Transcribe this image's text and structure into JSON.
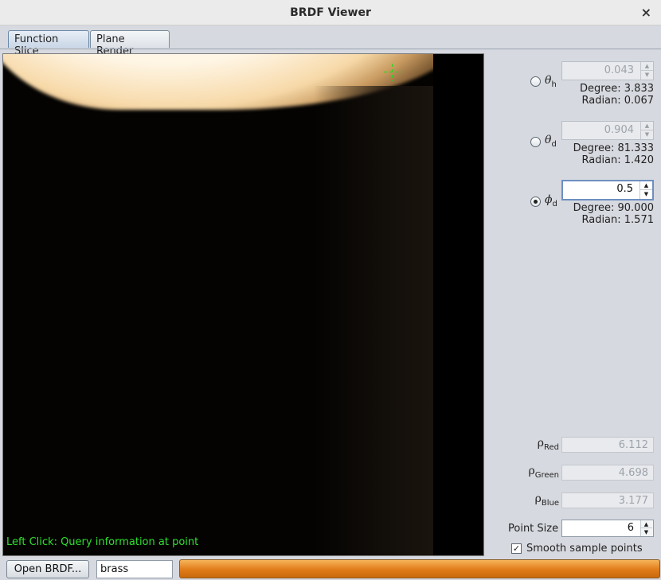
{
  "window": {
    "title": "BRDF Viewer",
    "close_glyph": "×"
  },
  "tabs": [
    {
      "label": "Function Slice",
      "active": true
    },
    {
      "label": "Plane Render",
      "active": false
    }
  ],
  "canvas": {
    "hint": "Left Click: Query information at point"
  },
  "params": {
    "theta_h": {
      "symbol": "θ",
      "sub": "h",
      "value": "0.043",
      "degree": "Degree: 3.833",
      "radian": "Radian: 0.067",
      "selected": false
    },
    "theta_d": {
      "symbol": "θ",
      "sub": "d",
      "value": "0.904",
      "degree": "Degree: 81.333",
      "radian": "Radian: 1.420",
      "selected": false
    },
    "phi_d": {
      "symbol": "ϕ",
      "sub": "d",
      "value": "0.5",
      "degree": "Degree: 90.000",
      "radian": "Radian: 1.571",
      "selected": true
    }
  },
  "rho": {
    "red": {
      "symbol": "ρ",
      "sub": "Red",
      "value": "6.112"
    },
    "green": {
      "symbol": "ρ",
      "sub": "Green",
      "value": "4.698"
    },
    "blue": {
      "symbol": "ρ",
      "sub": "Blue",
      "value": "3.177"
    }
  },
  "point_size": {
    "label": "Point Size",
    "value": "6"
  },
  "smooth": {
    "label": "Smooth sample points",
    "checked": true,
    "check_glyph": "✓"
  },
  "bottom": {
    "open_label": "Open BRDF...",
    "material": "brass",
    "progress_fraction": 1.0
  },
  "colors": {
    "progress": "#e07b18",
    "hint": "#2ee02e",
    "crosshair": "#1fd81f"
  }
}
